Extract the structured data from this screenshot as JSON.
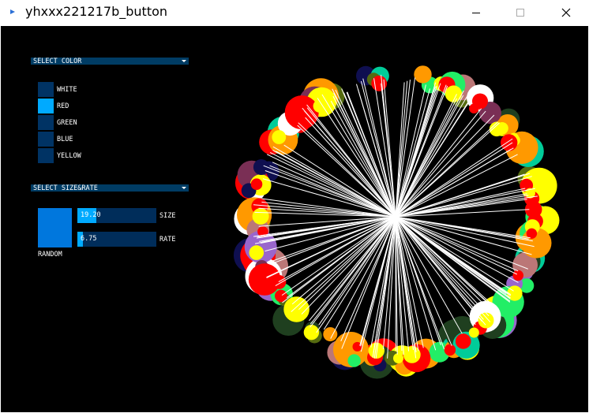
{
  "window": {
    "title": "yhxxx221217b_button",
    "buttons": [
      "minimize",
      "maximize",
      "close"
    ]
  },
  "controls": {
    "color_dropdown": {
      "label": "SELECT COLOR",
      "options": [
        {
          "label": "WHITE",
          "active": false
        },
        {
          "label": "RED",
          "active": true
        },
        {
          "label": "GREEN",
          "active": false
        },
        {
          "label": "BLUE",
          "active": false
        },
        {
          "label": "YELLOW",
          "active": false
        }
      ]
    },
    "size_rate_dropdown": {
      "label": "SELECT SIZE&RATE"
    },
    "random_button": {
      "label": "RANDOM"
    },
    "size_slider": {
      "label": "SIZE",
      "value": "19.20",
      "fraction": 0.24
    },
    "rate_slider": {
      "label": "RATE",
      "value": "6.75",
      "fraction": 0.07
    }
  },
  "palette": {
    "canvas_bg": "#000000",
    "gui_bg": "#003c64",
    "gui_active": "#00aaff",
    "circle_colors": [
      "#22ee66",
      "#ff0000",
      "#ffff00",
      "#9966cc",
      "#0f0f50",
      "#556b10",
      "#bb7777",
      "#00cc99",
      "#ff9900",
      "#7a2f55",
      "#ffffff",
      "#1f3f1f"
    ]
  }
}
